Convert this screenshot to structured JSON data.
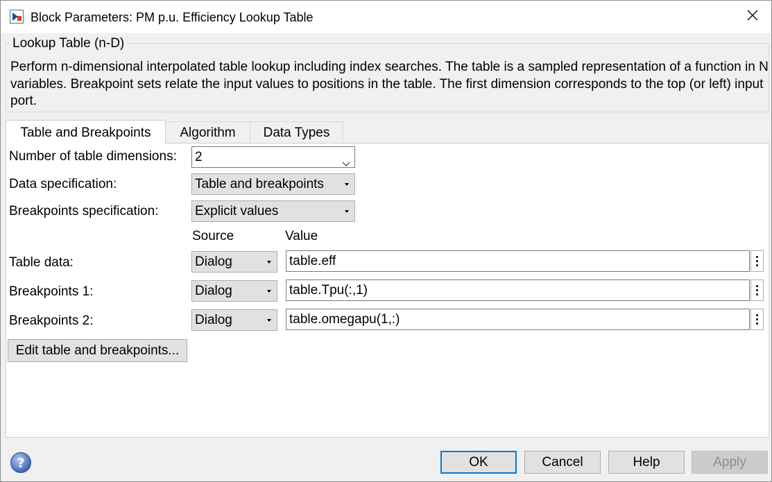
{
  "window": {
    "title": "Block Parameters: PM p.u. Efficiency Lookup Table"
  },
  "group": {
    "title": "Lookup Table (n-D)",
    "description": "Perform n-dimensional interpolated table lookup including index searches. The table is a sampled representation of a function in N variables. Breakpoint sets relate the input values to positions in the table. The first dimension corresponds to the top (or left) input port."
  },
  "tabs": [
    {
      "label": "Table and Breakpoints",
      "active": true
    },
    {
      "label": "Algorithm",
      "active": false
    },
    {
      "label": "Data Types",
      "active": false
    }
  ],
  "form": {
    "num_dims_label": "Number of table dimensions:",
    "num_dims_value": "2",
    "data_spec_label": "Data specification:",
    "data_spec_value": "Table and breakpoints",
    "bp_spec_label": "Breakpoints specification:",
    "bp_spec_value": "Explicit values",
    "source_header": "Source",
    "value_header": "Value",
    "rows": [
      {
        "label": "Table data:",
        "source": "Dialog",
        "value": "table.eff"
      },
      {
        "label": "Breakpoints 1:",
        "source": "Dialog",
        "value": "table.Tpu(:,1)"
      },
      {
        "label": "Breakpoints 2:",
        "source": "Dialog",
        "value": "table.omegapu(1,:)"
      }
    ],
    "edit_button": "Edit table and breakpoints..."
  },
  "buttons": {
    "ok": "OK",
    "cancel": "Cancel",
    "help": "Help",
    "apply": "Apply"
  },
  "colors": {
    "focus_accent": "#0078d7",
    "window_bg": "#f0f0f0",
    "panel_bg": "#ffffff"
  },
  "icons": {
    "title": "simulink-block-icon",
    "close": "close-icon",
    "help": "help-question-icon"
  }
}
